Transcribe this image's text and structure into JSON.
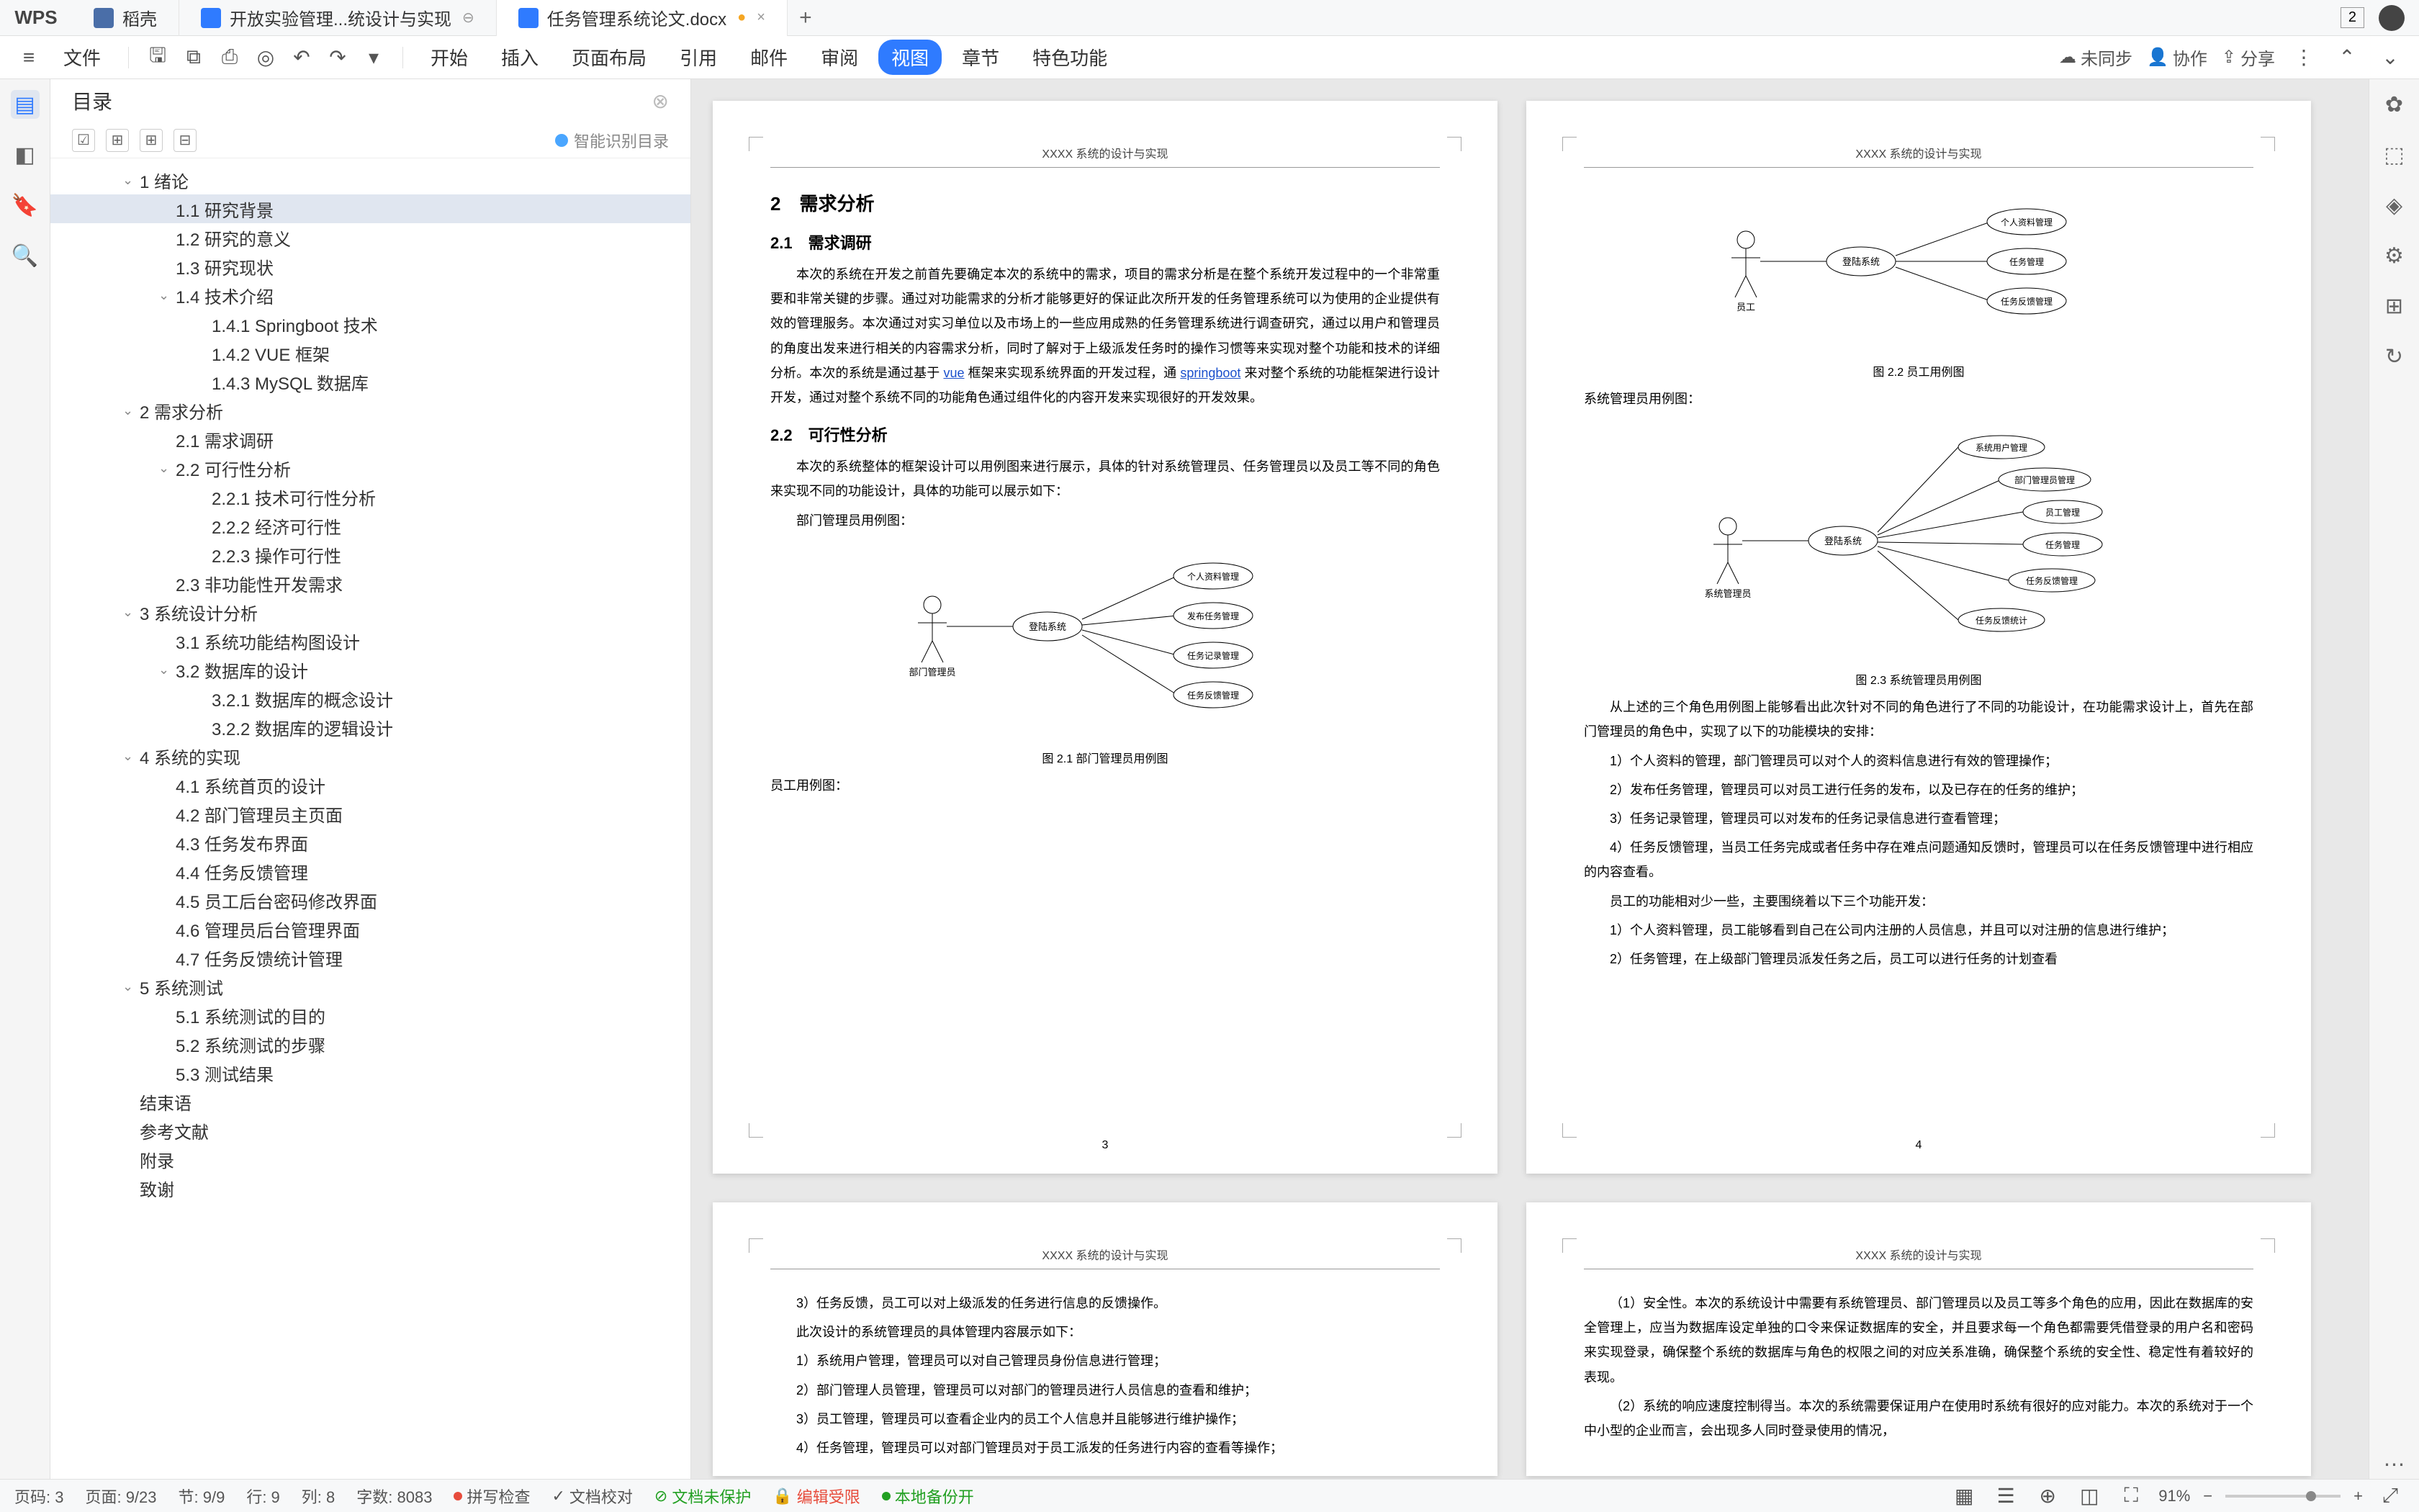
{
  "app": {
    "name": "WPS"
  },
  "tabs": [
    {
      "icon": "rice",
      "label": "稻壳"
    },
    {
      "icon": "docx",
      "label": "开放实验管理...统设计与实现"
    },
    {
      "icon": "docx",
      "label": "任务管理系统论文.docx",
      "dirty": true,
      "active": true
    }
  ],
  "titlebar": {
    "badge": "2"
  },
  "toolbar": {
    "file": "文件",
    "menus": [
      "开始",
      "插入",
      "页面布局",
      "引用",
      "邮件",
      "审阅",
      "视图",
      "章节",
      "特色功能"
    ],
    "active_menu": "视图",
    "right": {
      "sync": "未同步",
      "collab": "协作",
      "share": "分享"
    }
  },
  "outline": {
    "title": "目录",
    "smart_label": "智能识别目录",
    "items": [
      {
        "level": 0,
        "caret": true,
        "text": "1 绪论"
      },
      {
        "level": 1,
        "caret": false,
        "text": "1.1 研究背景",
        "selected": true
      },
      {
        "level": 1,
        "caret": false,
        "text": "1.2 研究的意义"
      },
      {
        "level": 1,
        "caret": false,
        "text": "1.3 研究现状"
      },
      {
        "level": 1,
        "caret": true,
        "text": "1.4 技术介绍"
      },
      {
        "level": 2,
        "caret": false,
        "text": "1.4.1 Springboot 技术"
      },
      {
        "level": 2,
        "caret": false,
        "text": "1.4.2 VUE 框架"
      },
      {
        "level": 2,
        "caret": false,
        "text": "1.4.3 MySQL 数据库"
      },
      {
        "level": 0,
        "caret": true,
        "text": "2 需求分析"
      },
      {
        "level": 1,
        "caret": false,
        "text": "2.1 需求调研"
      },
      {
        "level": 1,
        "caret": true,
        "text": "2.2 可行性分析"
      },
      {
        "level": 2,
        "caret": false,
        "text": "2.2.1 技术可行性分析"
      },
      {
        "level": 2,
        "caret": false,
        "text": "2.2.2 经济可行性"
      },
      {
        "level": 2,
        "caret": false,
        "text": "2.2.3 操作可行性"
      },
      {
        "level": 1,
        "caret": false,
        "text": "2.3 非功能性开发需求"
      },
      {
        "level": 0,
        "caret": true,
        "text": "3 系统设计分析"
      },
      {
        "level": 1,
        "caret": false,
        "text": "3.1 系统功能结构图设计"
      },
      {
        "level": 1,
        "caret": true,
        "text": "3.2 数据库的设计"
      },
      {
        "level": 2,
        "caret": false,
        "text": "3.2.1 数据库的概念设计"
      },
      {
        "level": 2,
        "caret": false,
        "text": "3.2.2 数据库的逻辑设计"
      },
      {
        "level": 0,
        "caret": true,
        "text": "4 系统的实现"
      },
      {
        "level": 1,
        "caret": false,
        "text": "4.1 系统首页的设计"
      },
      {
        "level": 1,
        "caret": false,
        "text": "4.2 部门管理员主页面"
      },
      {
        "level": 1,
        "caret": false,
        "text": "4.3 任务发布界面"
      },
      {
        "level": 1,
        "caret": false,
        "text": "4.4 任务反馈管理"
      },
      {
        "level": 1,
        "caret": false,
        "text": "4.5 员工后台密码修改界面"
      },
      {
        "level": 1,
        "caret": false,
        "text": "4.6 管理员后台管理界面"
      },
      {
        "level": 1,
        "caret": false,
        "text": "4.7 任务反馈统计管理"
      },
      {
        "level": 0,
        "caret": true,
        "text": "5 系统测试"
      },
      {
        "level": 1,
        "caret": false,
        "text": "5.1 系统测试的目的"
      },
      {
        "level": 1,
        "caret": false,
        "text": "5.2 系统测试的步骤"
      },
      {
        "level": 1,
        "caret": false,
        "text": "5.3 测试结果"
      },
      {
        "level": 0,
        "caret": false,
        "text": "结束语"
      },
      {
        "level": 0,
        "caret": false,
        "text": "参考文献"
      },
      {
        "level": 0,
        "caret": false,
        "text": "附录"
      },
      {
        "level": 0,
        "caret": false,
        "text": "致谢"
      }
    ]
  },
  "document": {
    "running_header": "XXXX 系统的设计与实现",
    "page3": {
      "h1": "2　需求分析",
      "h2a": "2.1　需求调研",
      "p1a": "本次的系统在开发之前首先要确定本次的系统中的需求，项目的需求分析是在整个系统开发过程中的一个非常重要和非常关键的步骤。通过对功能需求的分析才能够更好的保证此次所开发的任务管理系统可以为使用的企业提供有效的管理服务。本次通过对实习单位以及市场上的一些应用成熟的任务管理系统进行调查研究，通过以用户和管理员的角度出发来进行相关的内容需求分析，同时了解对于上级派发任务时的操作习惯等来实现对整个功能和技术的详细分析。本次的系统是通过基于 ",
      "link_vue": "vue",
      "p1b": " 框架来实现系统界面的开发过程，通 ",
      "link_sb": "springboot",
      "p1c": " 来对整个系统的功能框架进行设计开发，通过对整个系统不同的功能角色通过组件化的内容开发来实现很好的开发效果。",
      "h2b": "2.2　可行性分析",
      "p2": "本次的系统整体的框架设计可以用例图来进行展示，具体的针对系统管理员、任务管理员以及员工等不同的角色来实现不同的功能设计，具体的功能可以展示如下：",
      "p3": "部门管理员用例图：",
      "caption1": "图 2.1 部门管理员用例图",
      "p4": "员工用例图：",
      "page_num": "3",
      "uml1": {
        "actor": "部门管理员",
        "center": "登陆系统",
        "cases": [
          "个人资料管理",
          "发布任务管理",
          "任务记录管理",
          "任务反馈管理"
        ]
      }
    },
    "page4": {
      "caption2": "图 2.2 员工用例图",
      "p5": "系统管理员用例图：",
      "caption3": "图 2.3 系统管理员用例图",
      "p6": "从上述的三个角色用例图上能够看出此次针对不同的角色进行了不同的功能设计，在功能需求设计上，首先在部门管理员的角色中，实现了以下的功能模块的安排：",
      "li1": "1）个人资料的管理，部门管理员可以对个人的资料信息进行有效的管理操作；",
      "li2": "2）发布任务管理，管理员可以对员工进行任务的发布，以及已存在的任务的维护；",
      "li3": "3）任务记录管理，管理员可以对发布的任务记录信息进行查看管理；",
      "li4": "4）任务反馈管理，当员工任务完成或者任务中存在难点问题通知反馈时，管理员可以在任务反馈管理中进行相应的内容查看。",
      "p7": "员工的功能相对少一些，主要围绕着以下三个功能开发：",
      "li5": "1）个人资料管理，员工能够看到自己在公司内注册的人员信息，并且可以对注册的信息进行维护；",
      "li6": "2）任务管理，在上级部门管理员派发任务之后，员工可以进行任务的计划查看",
      "page_num": "4",
      "uml2": {
        "actor": "员工",
        "center": "登陆系统",
        "cases": [
          "个人资料管理",
          "任务管理",
          "任务反馈管理"
        ]
      },
      "uml3": {
        "actor": "系统管理员",
        "center": "登陆系统",
        "cases": [
          "系统用户管理",
          "部门管理员管理",
          "员工管理",
          "任务管理",
          "任务反馈管理",
          "任务反馈统计"
        ]
      }
    },
    "page5": {
      "li_a": "3）任务反馈，员工可以对上级派发的任务进行信息的反馈操作。",
      "p_a": "此次设计的系统管理员的具体管理内容展示如下：",
      "li_b": "1）系统用户管理，管理员可以对自己管理员身份信息进行管理；",
      "li_c": "2）部门管理人员管理，管理员可以对部门的管理员进行人员信息的查看和维护；",
      "li_d": "3）员工管理，管理员可以查看企业内的员工个人信息并且能够进行维护操作；",
      "li_e": "4）任务管理，管理员可以对部门管理员对于员工派发的任务进行内容的查看等操作；"
    },
    "page6": {
      "p_a": "（1）安全性。本次的系统设计中需要有系统管理员、部门管理员以及员工等多个角色的应用，因此在数据库的安全管理上，应当为数据库设定单独的口令来保证数据库的安全，并且要求每一个角色都需要凭借登录的用户名和密码来实现登录，确保整个系统的数据库与角色的权限之间的对应关系准确，确保整个系统的安全性、稳定性有着较好的表现。",
      "p_b": "（2）系统的响应速度控制得当。本次的系统需要保证用户在使用时系统有很好的应对能力。本次的系统对于一个中小型的企业而言，会出现多人同时登录使用的情况，"
    }
  },
  "status": {
    "page_no": "页码: 3",
    "page": "页面: 9/23",
    "section": "节: 9/9",
    "row": "行: 9",
    "col": "列: 8",
    "words": "字数: 8083",
    "spell": "拼写检查",
    "proof": "文档校对",
    "protect": "文档未保护",
    "edit": "编辑受限",
    "backup": "本地备份开",
    "zoom": "91%"
  }
}
